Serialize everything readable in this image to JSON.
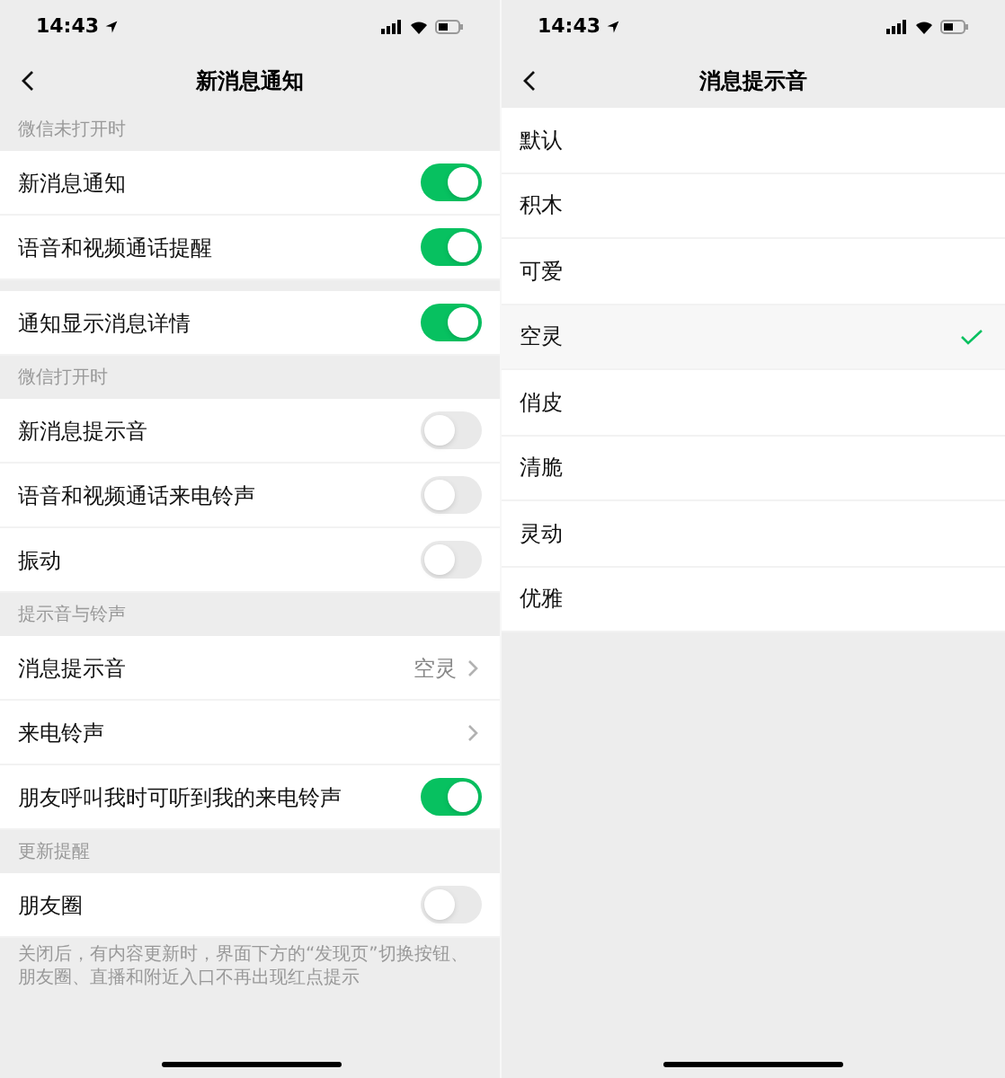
{
  "left_screen": {
    "status_bar": {
      "time": "14:43"
    },
    "title": "新消息通知",
    "sections": [
      {
        "header": "微信未打开时",
        "rows": [
          {
            "kind": "toggle",
            "label": "新消息通知",
            "on": true
          },
          {
            "kind": "toggle",
            "label": "语音和视频通话提醒",
            "on": true
          }
        ]
      },
      {
        "rows": [
          {
            "kind": "toggle",
            "label": "通知显示消息详情",
            "on": true
          }
        ]
      },
      {
        "header": "微信打开时",
        "rows": [
          {
            "kind": "toggle",
            "label": "新消息提示音",
            "on": false
          },
          {
            "kind": "toggle",
            "label": "语音和视频通话来电铃声",
            "on": false
          },
          {
            "kind": "toggle",
            "label": "振动",
            "on": false
          }
        ]
      },
      {
        "header": "提示音与铃声",
        "rows": [
          {
            "kind": "link",
            "label": "消息提示音",
            "value": "空灵"
          },
          {
            "kind": "link",
            "label": "来电铃声"
          },
          {
            "kind": "toggle",
            "label": "朋友呼叫我时可听到我的来电铃声",
            "on": true
          }
        ]
      },
      {
        "header": "更新提醒",
        "rows": [
          {
            "kind": "toggle",
            "label": "朋友圈",
            "on": false
          }
        ],
        "footnote": "关闭后，有内容更新时，界面下方的“发现页”切换按钮、朋友圈、直播和附近入口不再出现红点提示"
      }
    ]
  },
  "right_screen": {
    "status_bar": {
      "time": "14:43"
    },
    "title": "消息提示音",
    "options": [
      {
        "label": "默认",
        "selected": false
      },
      {
        "label": "积木",
        "selected": false
      },
      {
        "label": "可爱",
        "selected": false
      },
      {
        "label": "空灵",
        "selected": true
      },
      {
        "label": "俏皮",
        "selected": false
      },
      {
        "label": "清脆",
        "selected": false
      },
      {
        "label": "灵动",
        "selected": false
      },
      {
        "label": "优雅",
        "selected": false
      }
    ]
  }
}
